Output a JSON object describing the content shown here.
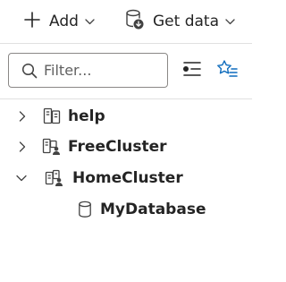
{
  "toolbar": {
    "add_label": "Add",
    "get_data_label": "Get data"
  },
  "filter": {
    "placeholder": "Filter..."
  },
  "tree": {
    "items": [
      {
        "label": "help",
        "expanded": false,
        "icon": "cluster-icon"
      },
      {
        "label": "FreeCluster",
        "expanded": false,
        "icon": "free-cluster-icon"
      },
      {
        "label": "HomeCluster",
        "expanded": true,
        "icon": "home-cluster-icon"
      },
      {
        "label": "MyDatabase",
        "icon": "database-icon"
      }
    ]
  },
  "colors": {
    "text": "#242424",
    "icon": "#424242",
    "accent": "#0f6cbd",
    "border": "#8a8886",
    "divider": "#e0e0e0"
  }
}
